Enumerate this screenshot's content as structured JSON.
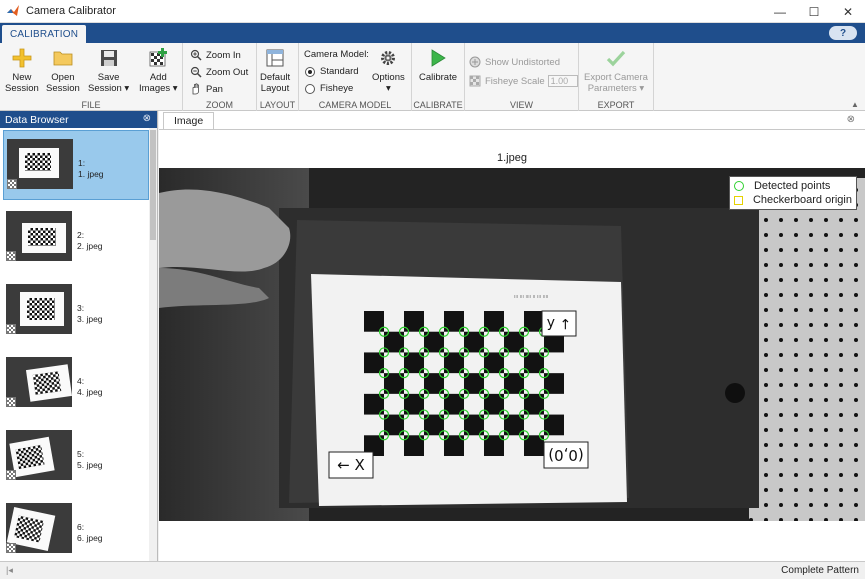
{
  "window": {
    "title": "Camera Calibrator",
    "controls": {
      "minimize": "—",
      "maximize": "☐",
      "close": "✕"
    }
  },
  "ribbon": {
    "active_tab": "CALIBRATION",
    "help_label": "?",
    "groups": {
      "file": {
        "label": "FILE",
        "new_session": [
          "New",
          "Session"
        ],
        "open_session": [
          "Open",
          "Session"
        ],
        "save_session": [
          "Save",
          "Session ▾"
        ],
        "add_images": [
          "Add",
          "Images ▾"
        ]
      },
      "zoom": {
        "label": "ZOOM",
        "zoom_in": "Zoom In",
        "zoom_out": "Zoom Out",
        "pan": "Pan"
      },
      "layout": {
        "label": "LAYOUT",
        "default_layout": [
          "Default",
          "Layout"
        ]
      },
      "camera_model": {
        "label": "CAMERA MODEL",
        "title": "Camera Model:",
        "standard": "Standard",
        "fisheye": "Fisheye",
        "selected": "Standard",
        "options": [
          "Options",
          "▾"
        ]
      },
      "calibrate": {
        "label": "CALIBRATE",
        "calibrate": "Calibrate"
      },
      "view": {
        "label": "VIEW",
        "show_undistorted": "Show Undistorted",
        "fisheye_scale": "Fisheye Scale",
        "fisheye_scale_value": "1.00"
      },
      "export": {
        "label": "EXPORT",
        "export_params": [
          "Export Camera",
          "Parameters ▾"
        ]
      }
    }
  },
  "data_browser": {
    "title": "Data Browser",
    "items": [
      {
        "index": "1:",
        "file": "1. jpeg"
      },
      {
        "index": "2:",
        "file": "2. jpeg"
      },
      {
        "index": "3:",
        "file": "3. jpeg"
      },
      {
        "index": "4:",
        "file": "4. jpeg"
      },
      {
        "index": "5:",
        "file": "5. jpeg"
      },
      {
        "index": "6:",
        "file": "6. jpeg"
      }
    ],
    "selected_index": 0
  },
  "image_panel": {
    "tab_label": "Image",
    "image_title": "1.jpeg",
    "legend": {
      "detected": "Detected points",
      "origin": "Checkerboard origin"
    },
    "axis_labels": {
      "y": "Y ↑",
      "x": "X ↑",
      "origin": "(0,0)"
    },
    "colors": {
      "detected": "#2fd12f",
      "origin": "#e6d200"
    }
  },
  "status": {
    "text": "Complete Pattern"
  }
}
